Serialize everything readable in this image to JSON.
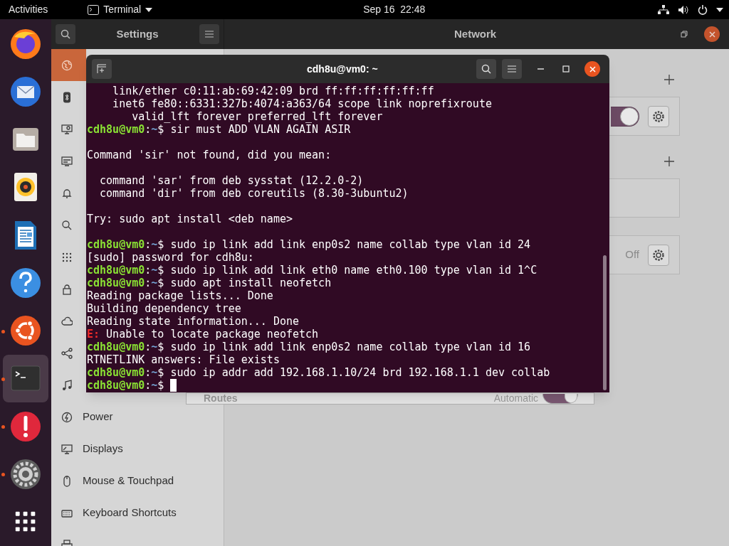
{
  "top_bar": {
    "activities": "Activities",
    "app_menu": "Terminal",
    "clock": "Sep 16  22:48"
  },
  "dock": [
    {
      "kind": "browser",
      "running": false,
      "active": false
    },
    {
      "kind": "mail",
      "running": false,
      "active": false
    },
    {
      "kind": "files",
      "running": false,
      "active": false
    },
    {
      "kind": "music",
      "running": false,
      "active": false
    },
    {
      "kind": "document",
      "running": false,
      "active": false
    },
    {
      "kind": "help",
      "running": false,
      "active": false
    },
    {
      "kind": "software",
      "running": true,
      "active": false
    },
    {
      "kind": "terminal",
      "running": true,
      "active": true
    },
    {
      "kind": "alert",
      "running": true,
      "active": false
    },
    {
      "kind": "settings",
      "running": true,
      "active": false
    },
    {
      "kind": "apps",
      "running": false,
      "active": false
    }
  ],
  "settings": {
    "title": "Settings",
    "page_title": "Network",
    "sidebar": [
      {
        "kind": "network",
        "selected": true
      },
      {
        "kind": "bluetooth",
        "selected": false
      },
      {
        "kind": "background",
        "selected": false
      },
      {
        "kind": "appearance",
        "selected": false
      },
      {
        "kind": "notifications",
        "selected": false
      },
      {
        "kind": "search",
        "selected": false
      },
      {
        "kind": "applications",
        "selected": false
      },
      {
        "kind": "privacy",
        "selected": false
      },
      {
        "kind": "online",
        "selected": false
      },
      {
        "kind": "sharing",
        "selected": false
      },
      {
        "kind": "sound",
        "selected": false
      },
      {
        "kind": "power",
        "label": "Power",
        "selected": false
      },
      {
        "kind": "displays",
        "label": "Displays",
        "selected": false
      },
      {
        "kind": "mouse",
        "label": "Mouse & Touchpad",
        "selected": false
      },
      {
        "kind": "keyboard",
        "label": "Keyboard Shortcuts",
        "selected": false
      },
      {
        "kind": "printers",
        "selected": false
      }
    ],
    "cards": [
      {
        "kind": "toggle",
        "on": true
      },
      {
        "kind": "empty"
      },
      {
        "kind": "status",
        "status": "Off"
      }
    ],
    "dialog": {
      "label": "Routes",
      "option": "Automatic",
      "on": true
    }
  },
  "terminal": {
    "title": "cdh8u@vm0: ~",
    "lines": [
      {
        "kind": "output",
        "text": "    link/ether c0:11:ab:69:42:09 brd ff:ff:ff:ff:ff:ff"
      },
      {
        "kind": "output",
        "text": "    inet6 fe80::6331:327b:4074:a363/64 scope link noprefixroute"
      },
      {
        "kind": "output",
        "text": "       valid_lft forever preferred_lft forever"
      },
      {
        "kind": "prompt",
        "user": "cdh8u@vm0",
        "sep": ":",
        "path": "~",
        "sign": "$",
        "command": "sir must ADD VLAN AGAIN ASIR"
      },
      {
        "kind": "blank"
      },
      {
        "kind": "output",
        "text": "Command 'sir' not found, did you mean:"
      },
      {
        "kind": "blank"
      },
      {
        "kind": "output",
        "text": "  command 'sar' from deb sysstat (12.2.0-2)"
      },
      {
        "kind": "output",
        "text": "  command 'dir' from deb coreutils (8.30-3ubuntu2)"
      },
      {
        "kind": "blank"
      },
      {
        "kind": "output",
        "text": "Try: sudo apt install <deb name>"
      },
      {
        "kind": "blank"
      },
      {
        "kind": "prompt",
        "user": "cdh8u@vm0",
        "sep": ":",
        "path": "~",
        "sign": "$",
        "command": "sudo ip link add link enp0s2 name collab type vlan id 24"
      },
      {
        "kind": "output",
        "text": "[sudo] password for cdh8u:"
      },
      {
        "kind": "prompt",
        "user": "cdh8u@vm0",
        "sep": ":",
        "path": "~",
        "sign": "$",
        "command": "sudo ip link add link eth0 name eth0.100 type vlan id 1^C"
      },
      {
        "kind": "prompt",
        "user": "cdh8u@vm0",
        "sep": ":",
        "path": "~",
        "sign": "$",
        "command": "sudo apt install neofetch"
      },
      {
        "kind": "output",
        "text": "Reading package lists... Done"
      },
      {
        "kind": "output",
        "text": "Building dependency tree"
      },
      {
        "kind": "output",
        "text": "Reading state information... Done"
      },
      {
        "kind": "error",
        "marker": "E:",
        "text": " Unable to locate package neofetch"
      },
      {
        "kind": "prompt",
        "user": "cdh8u@vm0",
        "sep": ":",
        "path": "~",
        "sign": "$",
        "command": "sudo ip link add link enp0s2 name collab type vlan id 16"
      },
      {
        "kind": "output",
        "text": "RTNETLINK answers: File exists"
      },
      {
        "kind": "prompt",
        "user": "cdh8u@vm0",
        "sep": ":",
        "path": "~",
        "sign": "$",
        "command": "sudo ip addr add 192.168.1.10/24 brd 192.168.1.1 dev collab"
      },
      {
        "kind": "prompt",
        "user": "cdh8u@vm0",
        "sep": ":",
        "path": "~",
        "sign": "$",
        "cursor": true
      }
    ]
  }
}
